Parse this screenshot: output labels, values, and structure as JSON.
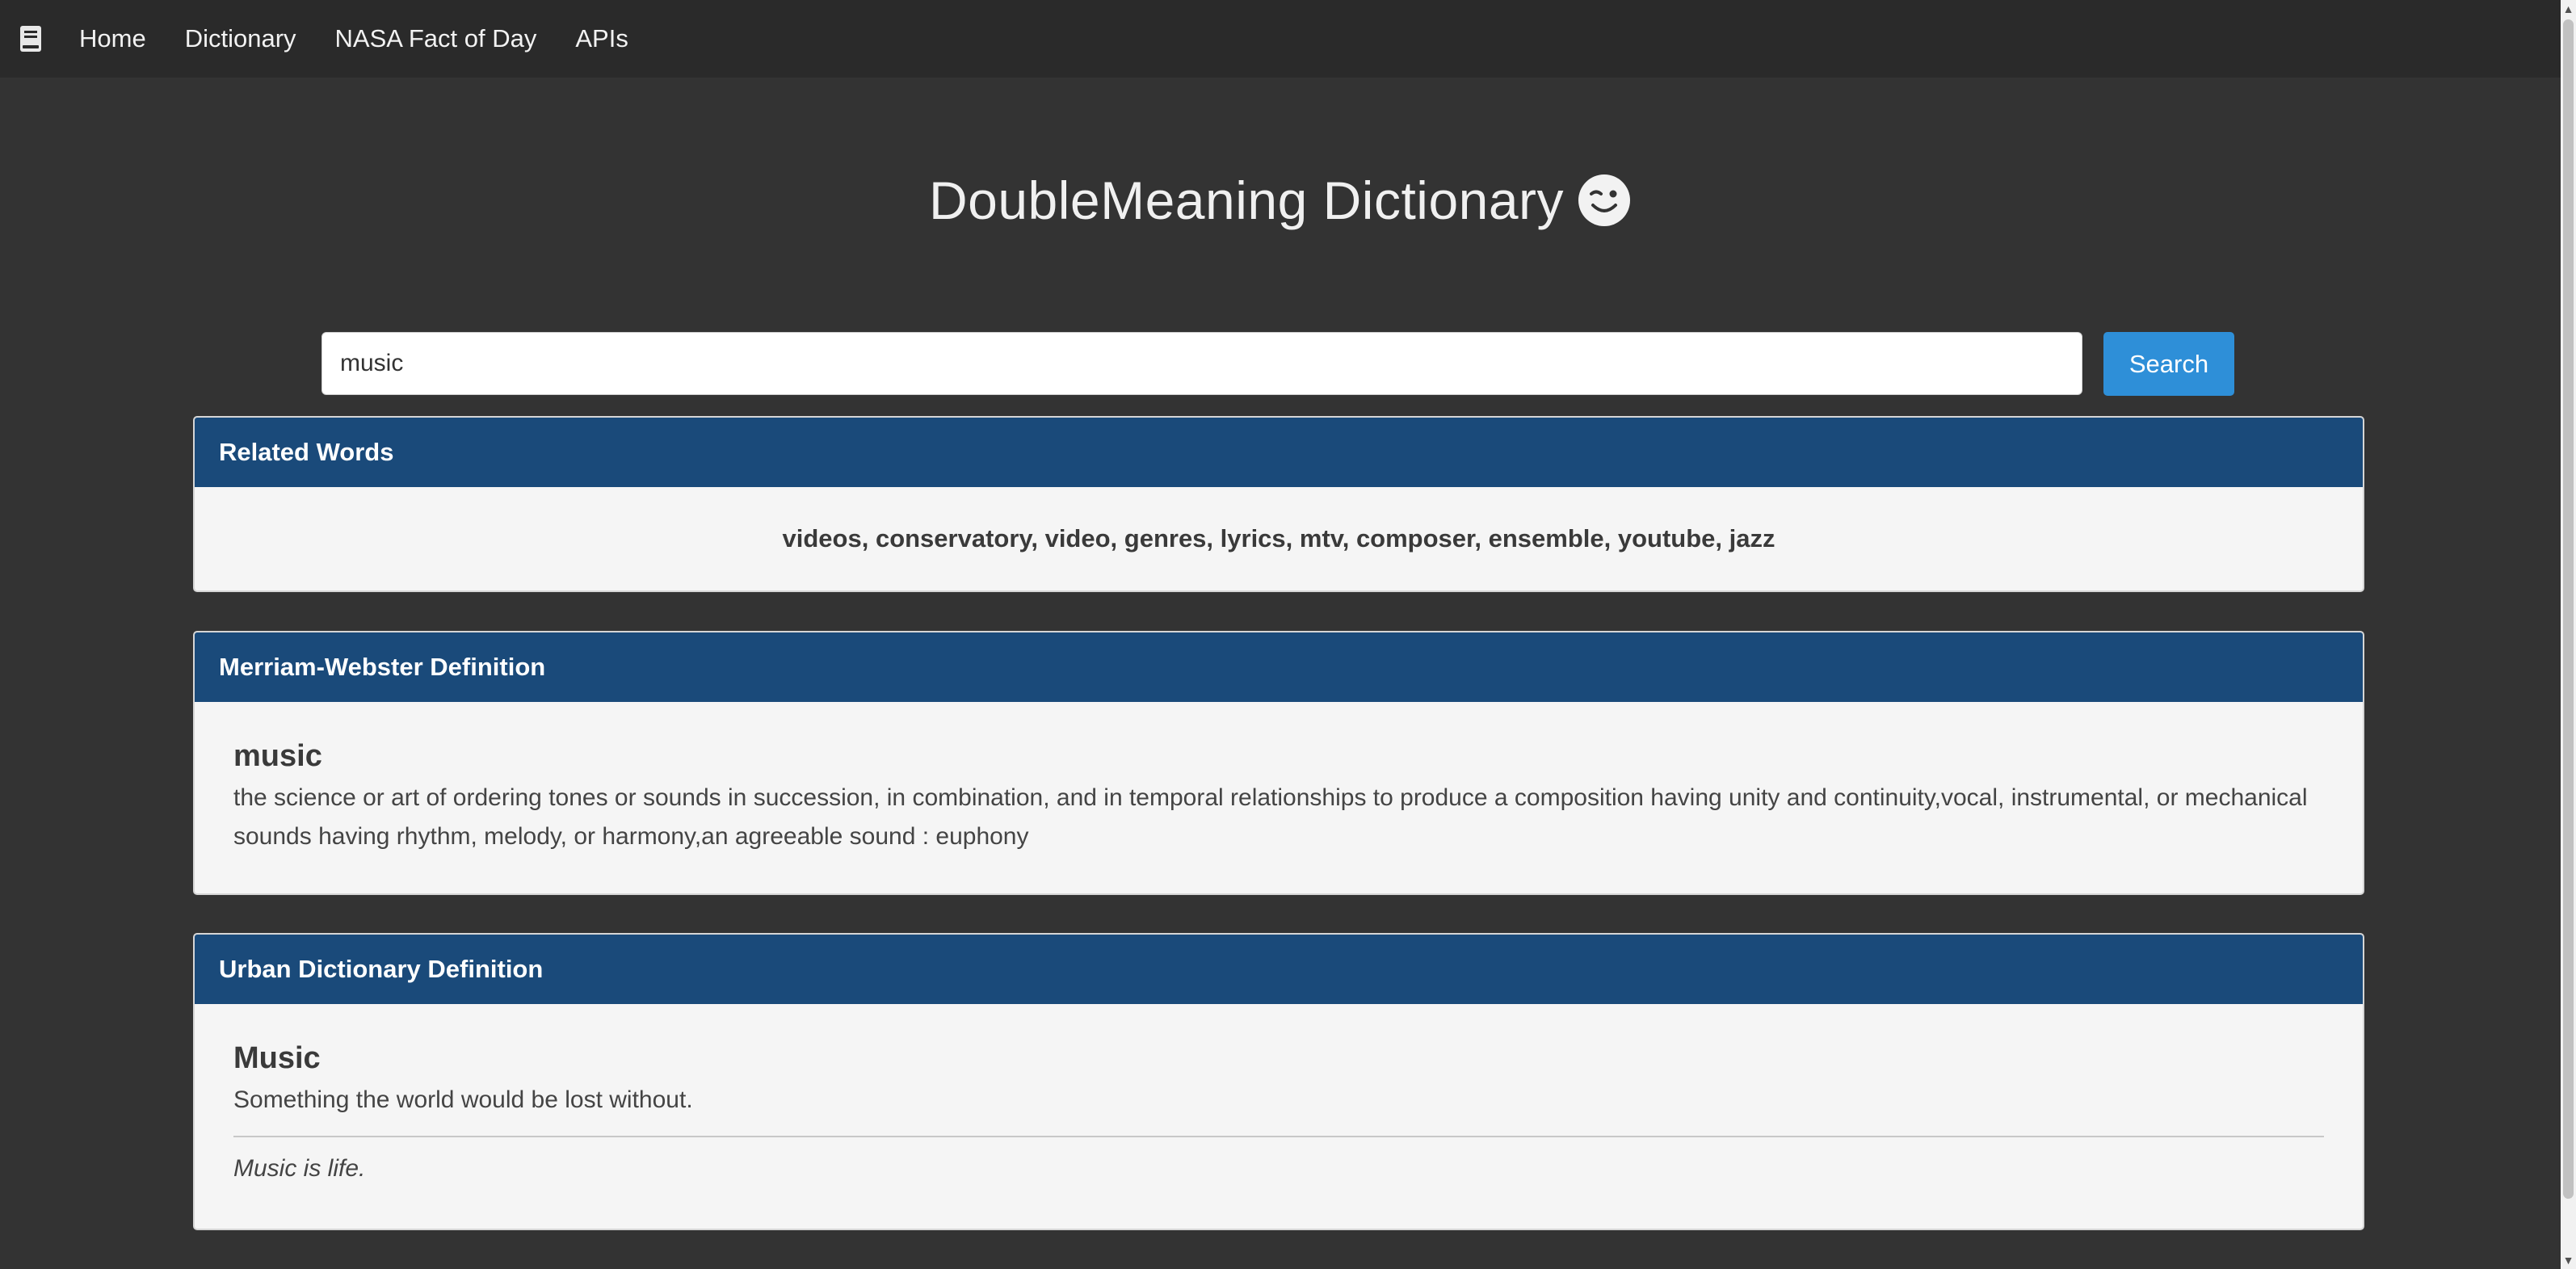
{
  "nav": {
    "logo_icon": "book-icon",
    "links": [
      "Home",
      "Dictionary",
      "NASA Fact of Day",
      "APIs"
    ]
  },
  "header": {
    "title": "DoubleMeaning Dictionary",
    "emoji_icon": "wink-emoji-icon"
  },
  "search": {
    "value": "music",
    "placeholder": "",
    "button_label": "Search"
  },
  "panels": {
    "related": {
      "heading": "Related Words",
      "words": "videos, conservatory, video, genres, lyrics, mtv, composer, ensemble, youtube, jazz"
    },
    "merriam": {
      "heading": "Merriam-Webster Definition",
      "word": "music",
      "definition": "the science or art of ordering tones or sounds in succession, in combination, and in temporal relationships to produce a composition having unity and continuity,vocal, instrumental, or mechanical sounds having rhythm, melody, or harmony,an agreeable sound : euphony"
    },
    "urban": {
      "heading": "Urban Dictionary Definition",
      "word": "Music",
      "definition": "Something the world would be lost without.",
      "example": "Music is life."
    }
  },
  "colors": {
    "page_bg": "#333333",
    "navbar_bg": "#2a2a2a",
    "panel_heading_bg": "#1a4a7a",
    "panel_body_bg": "#f5f5f5",
    "search_button_bg": "#2e8fd8"
  }
}
